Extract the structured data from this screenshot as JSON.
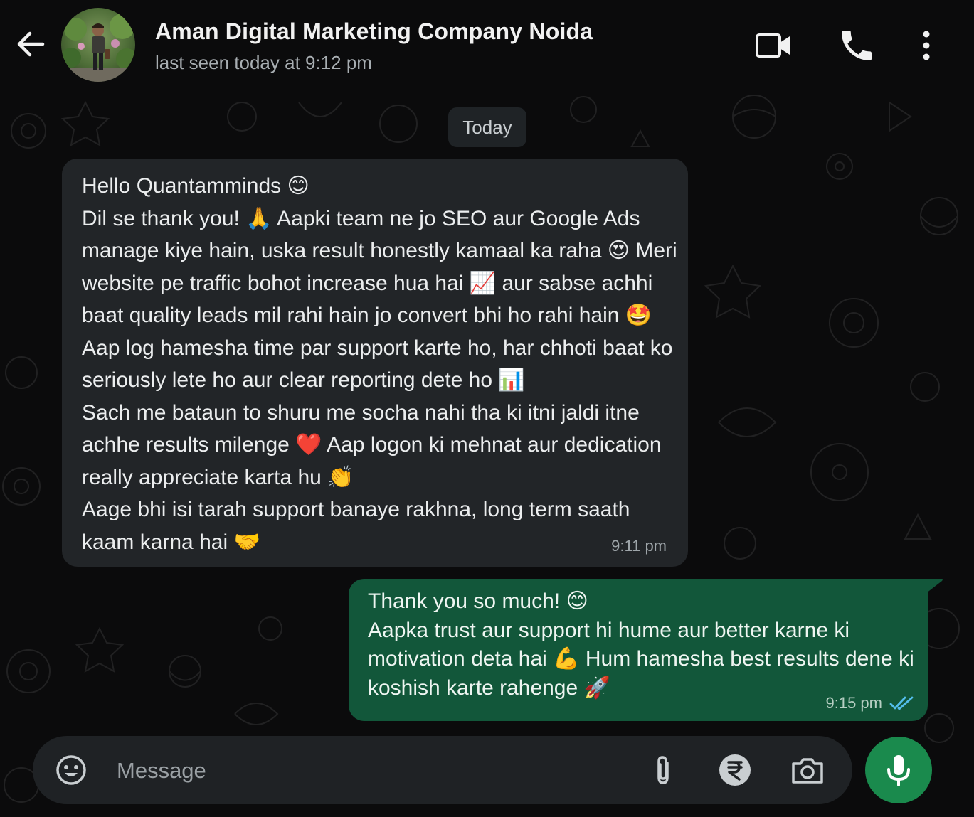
{
  "header": {
    "contact_name": "Aman Digital Marketing Company Noida",
    "last_seen": "last seen today at 9:12 pm"
  },
  "chat": {
    "date_chip": "Today",
    "messages": [
      {
        "direction": "incoming",
        "text": "Hello Quantamminds 😊\nDil se thank you! 🙏 Aapki team ne jo SEO aur Google Ads manage kiye hain, uska result honestly kamaal ka raha 😍 Meri website pe traffic bohot increase hua hai 📈 aur sabse achhi baat quality leads mil rahi hain jo convert bhi ho rahi hain 🤩 Aap log hamesha time par support karte ho, har chhoti baat ko seriously lete ho aur clear reporting dete ho 📊\nSach me bataun to shuru me socha nahi tha ki itni jaldi itne achhe results milenge ❤️ Aap logon ki mehnat aur dedication really appreciate karta hu 👏\nAage bhi isi tarah support banaye rakhna, long term saath kaam karna hai 🤝",
        "time": "9:11 pm"
      },
      {
        "direction": "outgoing",
        "text": "Thank you so much! 😊\nAapka trust aur support hi hume aur better karne ki motivation deta hai 💪 Hum hamesha best results dene ki koshish karte rahenge 🚀",
        "time": "9:15 pm",
        "status": "read"
      }
    ]
  },
  "composer": {
    "placeholder": "Message"
  },
  "icons": {
    "back": "back-arrow-icon",
    "video": "video-call-icon",
    "call": "phone-icon",
    "menu": "more-vert-icon",
    "emoji": "emoji-icon",
    "attach": "paperclip-icon",
    "payment": "rupee-icon",
    "camera": "camera-icon",
    "mic": "mic-icon"
  },
  "colors": {
    "background": "#0b0b0c",
    "incoming_bubble": "#222528",
    "outgoing_bubble": "#12573a",
    "accent_green": "#1a8a4d",
    "read_ticks": "#53bdeb"
  }
}
